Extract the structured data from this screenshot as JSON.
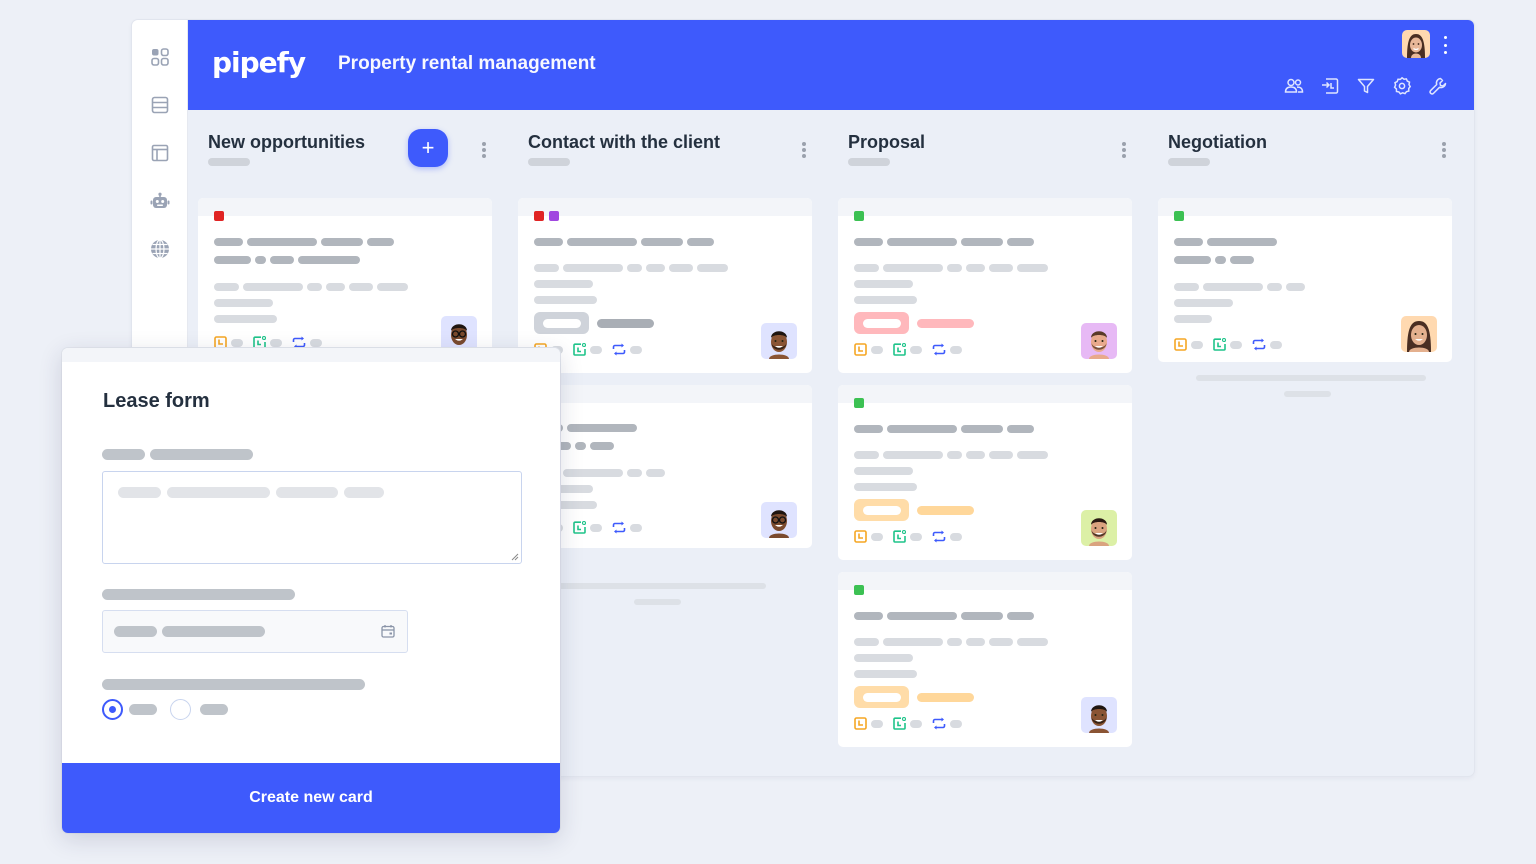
{
  "app": {
    "logo": "pipefy",
    "pipe_title": "Property rental management",
    "brand_color": "#3e5afc",
    "toolbar_icons": [
      "members-icon",
      "import-icon",
      "filter-icon",
      "settings-icon",
      "wrench-icon"
    ],
    "sidenav_icons": [
      "apps-grid-icon",
      "database-icon",
      "layout-icon",
      "bot-icon",
      "globe-icon"
    ]
  },
  "phases": [
    {
      "title": "New opportunities",
      "has_add_button": true,
      "add_label": "+",
      "cards": [
        {
          "labels": [
            "#e02424"
          ],
          "tag_color": null,
          "avatar": "person-glasses"
        }
      ]
    },
    {
      "title": "Contact with the client",
      "cards": [
        {
          "labels": [
            "#e02424",
            "#a047e0"
          ],
          "tag_color": "#cfd3da",
          "avatar": "person-beard"
        },
        {
          "labels": [],
          "tag_color": null,
          "avatar": "person-glasses"
        }
      ]
    },
    {
      "title": "Proposal",
      "cards": [
        {
          "labels": [
            "#3cc153"
          ],
          "tag_color": "#ffb8bc",
          "avatar": "person-smile-pink"
        },
        {
          "labels": [
            "#3cc153"
          ],
          "tag_color": "#ffdca8",
          "avatar": "person-smile-green"
        },
        {
          "labels": [
            "#3cc153"
          ],
          "tag_color": "#ffdca8",
          "avatar": "person-beard"
        }
      ]
    },
    {
      "title": "Negotiation",
      "cards": [
        {
          "labels": [
            "#3cc153"
          ],
          "tag_color": null,
          "avatar": "person-woman"
        }
      ]
    }
  ],
  "card_icons": [
    "due-date-icon",
    "checklist-icon",
    "repeat-icon"
  ],
  "form": {
    "title": "Lease form",
    "submit_label": "Create new card",
    "radio_selected_index": 0,
    "date_icon": "calendar-icon"
  }
}
